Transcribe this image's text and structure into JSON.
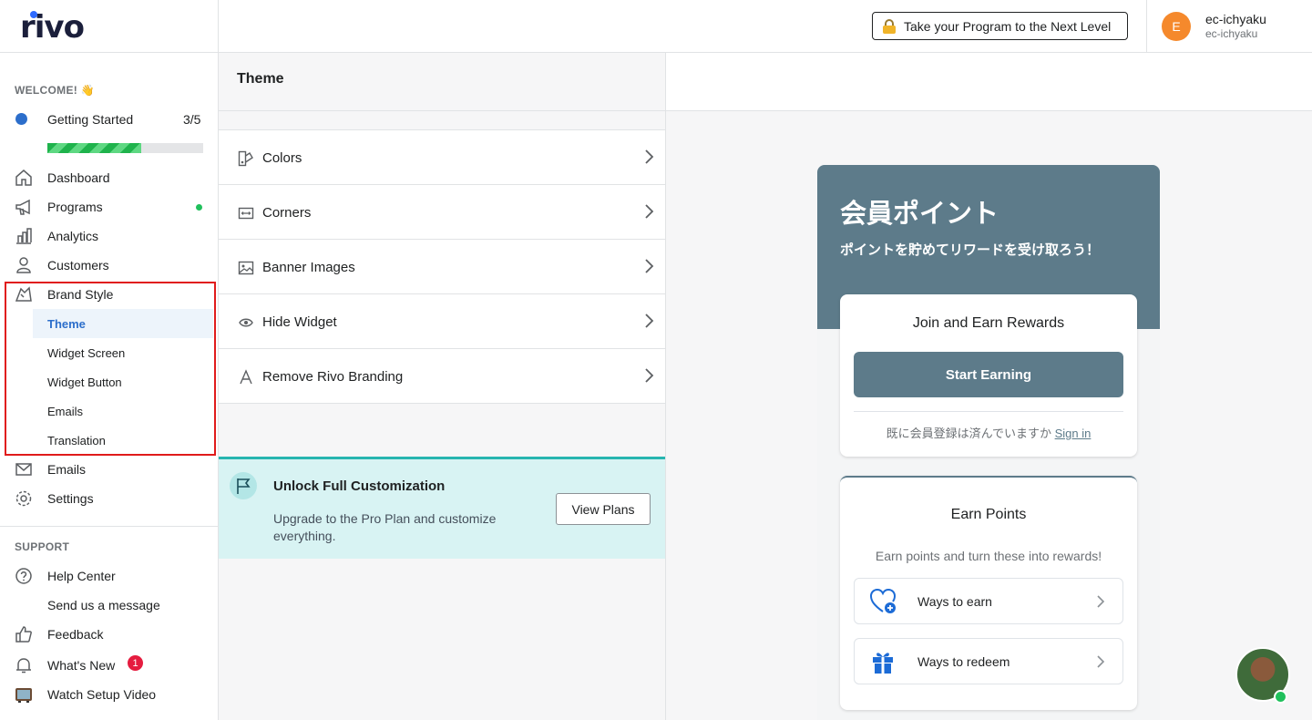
{
  "brand": {
    "logo_text": "rivo",
    "accent": "#2c6ecb"
  },
  "topbar": {
    "upgrade_label": "Take your Program to the Next Level",
    "user_initial": "E",
    "user_name": "ec-ichyaku",
    "user_store": "ec-ichyaku"
  },
  "sidebar": {
    "welcome": "WELCOME! 👋",
    "getting_started": {
      "label": "Getting Started",
      "count": "3/5",
      "progress": 0.6
    },
    "items": [
      {
        "label": "Dashboard",
        "icon": "home-icon"
      },
      {
        "label": "Programs",
        "icon": "megaphone-icon",
        "status_dot": "green"
      },
      {
        "label": "Analytics",
        "icon": "bar-chart-icon"
      },
      {
        "label": "Customers",
        "icon": "person-icon"
      },
      {
        "label": "Brand Style",
        "icon": "paint-icon"
      }
    ],
    "brand_style_sub": [
      {
        "label": "Theme",
        "active": true
      },
      {
        "label": "Widget Screen"
      },
      {
        "label": "Widget Button"
      },
      {
        "label": "Emails"
      },
      {
        "label": "Translation"
      }
    ],
    "items_after": [
      {
        "label": "Emails",
        "icon": "envelope-icon"
      },
      {
        "label": "Settings",
        "icon": "gear-icon"
      }
    ],
    "support_title": "SUPPORT",
    "support_items": [
      {
        "label": "Help Center",
        "icon": "question-icon"
      },
      {
        "label": "Send us a message",
        "icon": ""
      },
      {
        "label": "Feedback",
        "icon": "thumbs-up-icon"
      },
      {
        "label": "What's New",
        "icon": "bell-icon",
        "badge": "1"
      },
      {
        "label": "Watch Setup Video",
        "icon": "tv-icon"
      }
    ]
  },
  "theme_panel": {
    "title": "Theme",
    "menu": [
      {
        "label": "Colors",
        "icon": "palette-icon"
      },
      {
        "label": "Corners",
        "icon": "corners-icon"
      },
      {
        "label": "Banner Images",
        "icon": "image-icon"
      },
      {
        "label": "Hide Widget",
        "icon": "eye-icon"
      },
      {
        "label": "Remove Rivo Branding",
        "icon": "letter-a-icon"
      }
    ],
    "promo": {
      "title": "Unlock Full Customization",
      "description": "Upgrade to the Pro Plan and customize everything.",
      "button": "View Plans"
    }
  },
  "preview": {
    "title": "会員ポイント",
    "subtitle": "ポイントを貯めてリワードを受け取ろう！",
    "join_card": {
      "title": "Join and Earn Rewards",
      "button": "Start Earning",
      "signin_prefix": "既に会員登録は済んでいますか",
      "signin_link": "Sign in"
    },
    "earn_card": {
      "title": "Earn Points",
      "description": "Earn points and turn these into rewards!",
      "ways": [
        {
          "label": "Ways to earn",
          "icon": "heart-plus-icon"
        },
        {
          "label": "Ways to redeem",
          "icon": "gift-icon"
        }
      ]
    },
    "header_color": "#5d7b8a"
  }
}
